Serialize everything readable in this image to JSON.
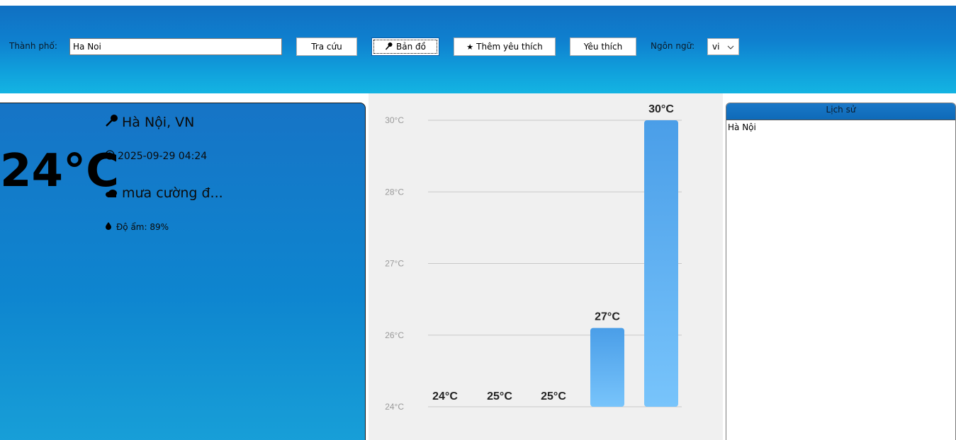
{
  "toolbar": {
    "city_label": "Thành phố:",
    "city_value": "Ha Noi",
    "search_label": "Tra cứu",
    "map_label": "Bản đồ",
    "add_fav_label": "Thêm yêu thích",
    "favorites_label": "Yêu thích",
    "language_label": "Ngôn ngữ:",
    "language_value": "vi"
  },
  "current": {
    "temperature": "24°C",
    "location": "Hà Nội, VN",
    "datetime": "2025-09-29 04:24",
    "description": "mưa cường đ...",
    "humidity": "Độ ẩm: 89%"
  },
  "history": {
    "title": "Lịch sử",
    "items": [
      "Hà Nội"
    ]
  },
  "chart_data": {
    "type": "bar",
    "values": [
      24,
      25.3,
      25.4,
      27.1,
      30
    ],
    "data_labels": [
      "24°C",
      "25°C",
      "25°C",
      "27°C",
      "30°C"
    ],
    "ytick_labels": [
      "30°C",
      "28°C",
      "27°C",
      "26°C",
      "24°C"
    ],
    "yticks": [
      30,
      29,
      28,
      27,
      26
    ],
    "ylim": [
      26,
      30
    ],
    "grid": true,
    "bar_color_top": "#4a9ee8",
    "bar_color_bottom": "#78c4fb"
  },
  "colors": {
    "accent": "#1070c2"
  }
}
